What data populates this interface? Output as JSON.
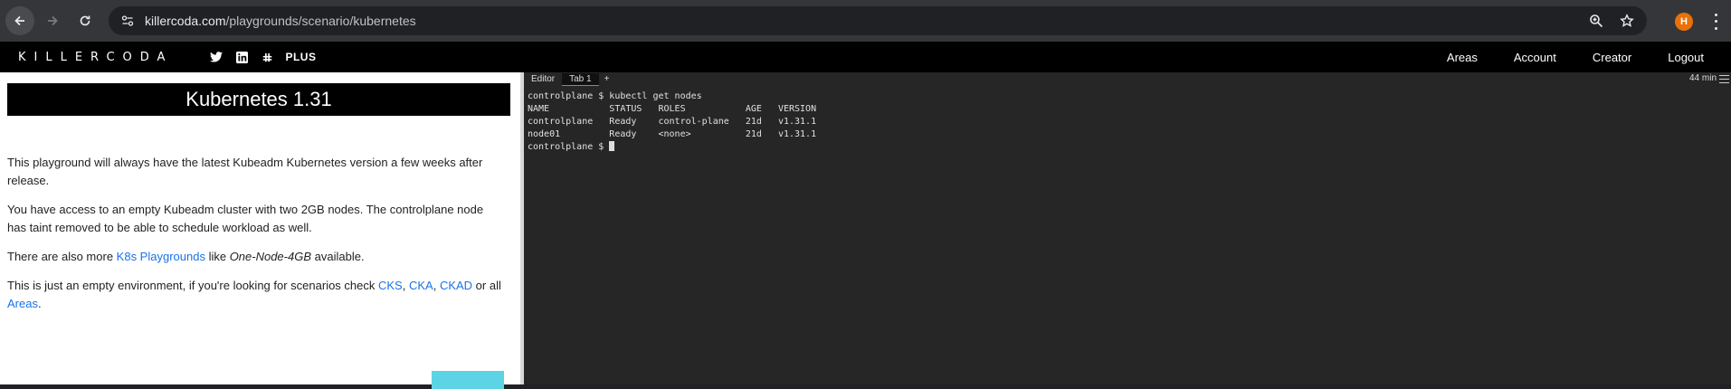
{
  "browser": {
    "url_host": "killercoda.com",
    "url_path": "/playgrounds/scenario/kubernetes",
    "profile_initial": "H",
    "icons": [
      "back-icon",
      "forward-icon",
      "reload-icon",
      "site-settings-icon",
      "zoom-icon",
      "bookmark-star-icon",
      "kebab-menu-icon"
    ]
  },
  "site": {
    "logo": "KILLERCODA",
    "plus_label": "PLUS",
    "nav": [
      "Areas",
      "Account",
      "Creator",
      "Logout"
    ]
  },
  "scenario": {
    "title": "Kubernetes 1.31",
    "p1": "This playground will always have the latest Kubeadm Kubernetes version a few weeks after release.",
    "p2": "You have access to an empty Kubeadm cluster with two 2GB nodes. The controlplane node has taint removed to be able to schedule workload as well.",
    "p3_pre": "There are also more ",
    "p3_link": "K8s Playgrounds",
    "p3_mid": " like ",
    "p3_em": "One-Node-4GB",
    "p3_post": " available.",
    "p4_pre": "This is just an empty environment, if you're looking for scenarios check ",
    "p4_l1": "CKS",
    "p4_s1": ", ",
    "p4_l2": "CKA",
    "p4_s2": ", ",
    "p4_l3": "CKAD",
    "p4_s3": " or all ",
    "p4_l4": "Areas",
    "p4_post": "."
  },
  "terminal": {
    "tabs": [
      "Editor",
      "Tab 1",
      "+"
    ],
    "active_tab": "Tab 1",
    "timer": "44 min",
    "lines": [
      "controlplane $ kubectl get nodes",
      "NAME           STATUS   ROLES           AGE   VERSION",
      "controlplane   Ready    control-plane   21d   v1.31.1",
      "node01         Ready    <none>          21d   v1.31.1"
    ],
    "prompt": "controlplane $ "
  },
  "colors": {
    "link": "#1a73e8",
    "terminal_bg": "#262626",
    "start_button": "#5dd3e6"
  }
}
